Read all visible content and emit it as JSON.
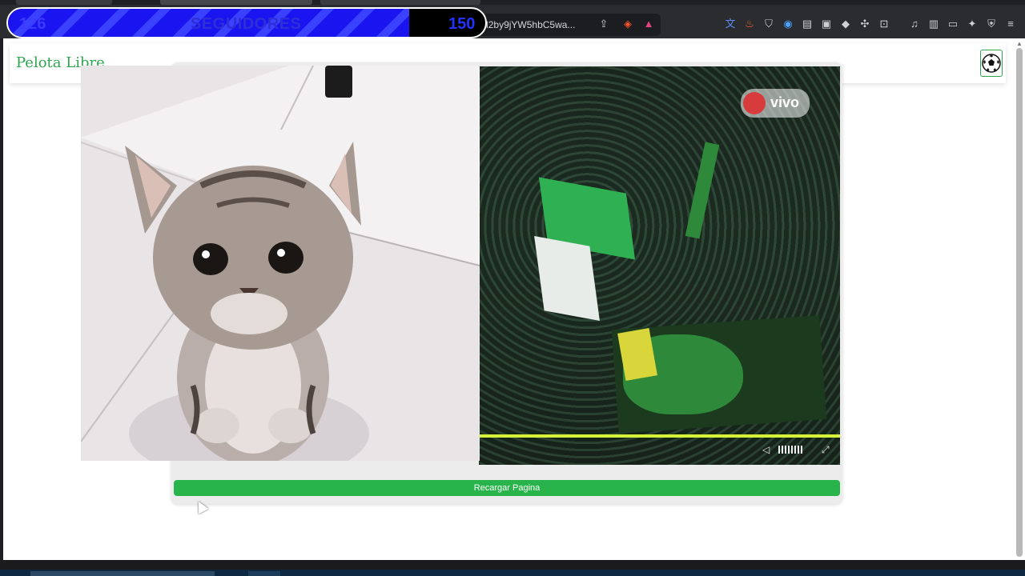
{
  "overlay": {
    "follower_count": "126",
    "follower_label": "SEGUIDORES",
    "follower_goal": "150",
    "progress_fraction": 0.84
  },
  "browser": {
    "url": "00aW9nb2x0...vdmI2by9jYW5hbC5wa...",
    "url_partial_visible": "00aW9nb2x... vdml2by9jYW5hbC5wa..."
  },
  "site": {
    "title": "Pelota Libre",
    "reload_label": "Recargar Pagina"
  },
  "video": {
    "live_badge": "vivo",
    "progress_fraction": 1.0
  },
  "colors": {
    "brand_green": "#2da44e",
    "button_green": "#28b44b",
    "progress_yellow": "#d6f238",
    "follower_blue": "#1a14f0"
  },
  "icons": {
    "ball": "soccer-ball-icon",
    "share": "share-icon",
    "brave": "brave-lion-icon",
    "rewards": "brave-rewards-icon",
    "volume": "volume-icon",
    "fullscreen": "fullscreen-icon"
  }
}
